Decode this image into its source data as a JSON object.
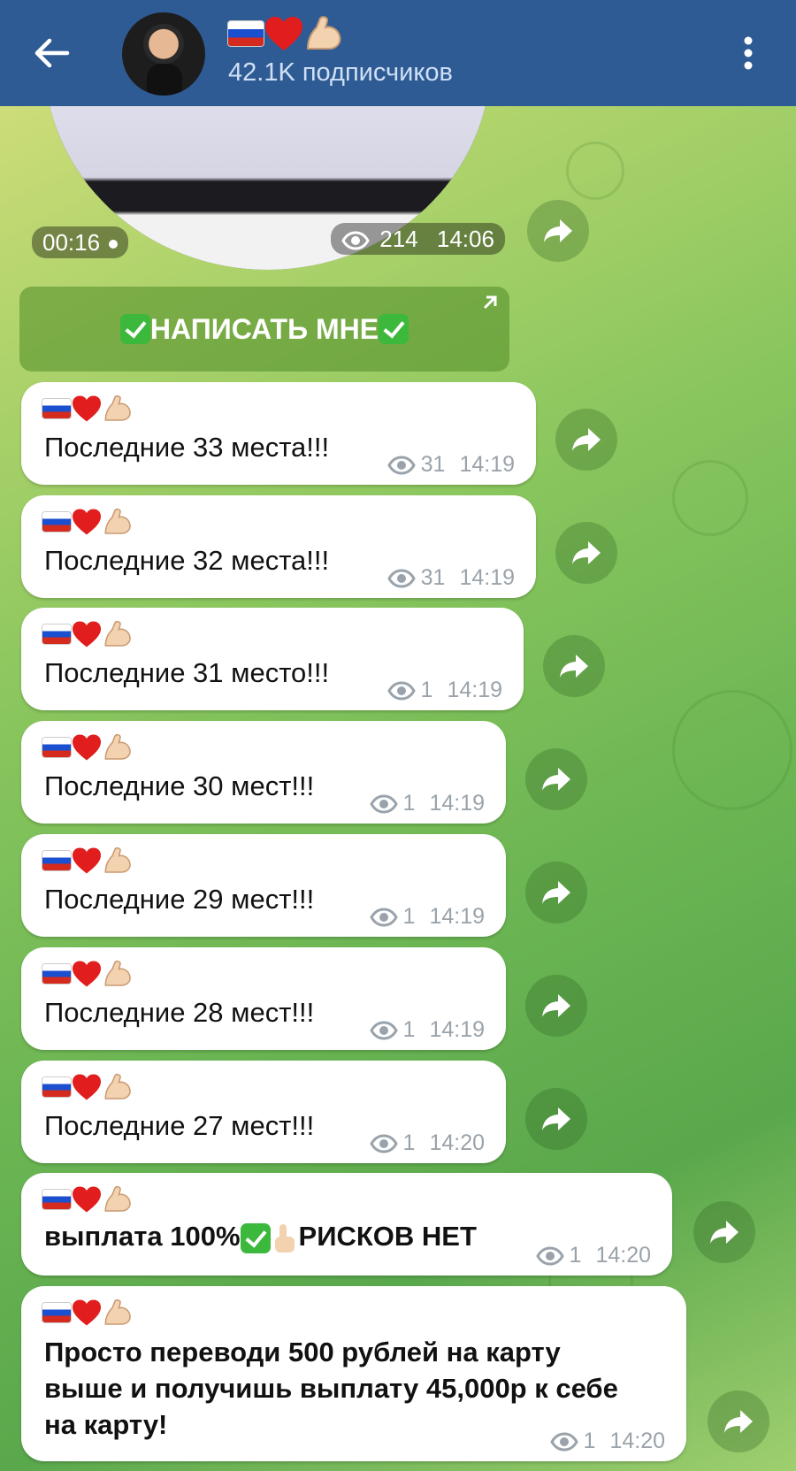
{
  "header": {
    "title": "🇷🇺❤️💪",
    "subscribers": "42.1K подписчиков"
  },
  "video": {
    "duration": "00:16",
    "views": "214",
    "time": "14:06"
  },
  "cta": {
    "label": "НАПИСАТЬ МНЕ"
  },
  "messages": [
    {
      "text": "Последние 33 места!!!",
      "views": "31",
      "time": "14:19"
    },
    {
      "text": "Последние 32 места!!!",
      "views": "31",
      "time": "14:19"
    },
    {
      "text": "Последние 31 место!!!",
      "views": "1",
      "time": "14:19"
    },
    {
      "text": "Последние 30 мест!!!",
      "views": "1",
      "time": "14:19"
    },
    {
      "text": "Последние 29 мест!!!",
      "views": "1",
      "time": "14:19"
    },
    {
      "text": "Последние 28 мест!!!",
      "views": "1",
      "time": "14:19"
    },
    {
      "text": "Последние 27 мест!!!",
      "views": "1",
      "time": "14:20"
    },
    {
      "text_a": "выплата 100%",
      "text_b": "РИСКОВ НЕТ",
      "views": "1",
      "time": "14:20"
    },
    {
      "line1": "Просто переводи 500 рублей на карту",
      "line2": "выше и получишь выплату 45,000р к себе",
      "line3": "на карту!",
      "views": "1",
      "time": "14:20"
    }
  ],
  "colors": {
    "header": "#2f5b94",
    "accent_check": "#3cb83c"
  }
}
